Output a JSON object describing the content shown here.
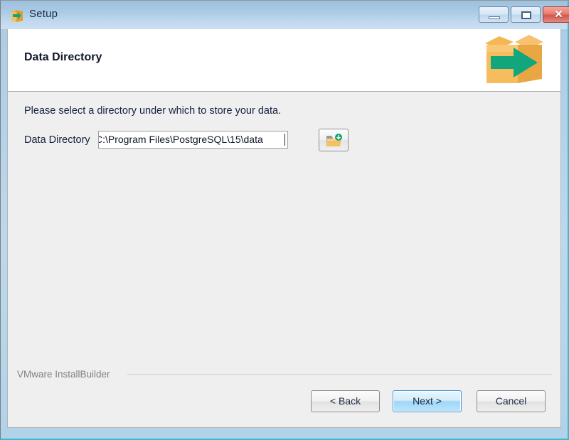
{
  "window": {
    "title": "Setup",
    "icon": "installer-box-icon",
    "controls": {
      "minimize_label": "–",
      "maximize_label": "□",
      "close_label": "✕"
    }
  },
  "header": {
    "page_title": "Data Directory",
    "logo": "installbuilder-box-arrow-logo"
  },
  "body": {
    "instruction": "Please select a directory under which to store your data.",
    "field": {
      "label": "Data Directory",
      "value": "C:\\Program Files\\PostgreSQL\\15\\data",
      "browse_icon": "folder-open-icon"
    }
  },
  "footer": {
    "brand": "VMware InstallBuilder",
    "buttons": {
      "back": "< Back",
      "next": "Next >",
      "cancel": "Cancel"
    }
  },
  "colors": {
    "title_bar_top": "#9dc0dd",
    "title_bar_bottom": "#cbdff1",
    "frame_accent": "#3fb8cc",
    "body_background": "#efefef",
    "header_background": "#ffffff",
    "logo_box": "#f2b44d",
    "logo_arrow": "#12a67c",
    "next_button_border": "#3c93d6",
    "close_button": "#d2564a",
    "brand_text": "#818181"
  }
}
